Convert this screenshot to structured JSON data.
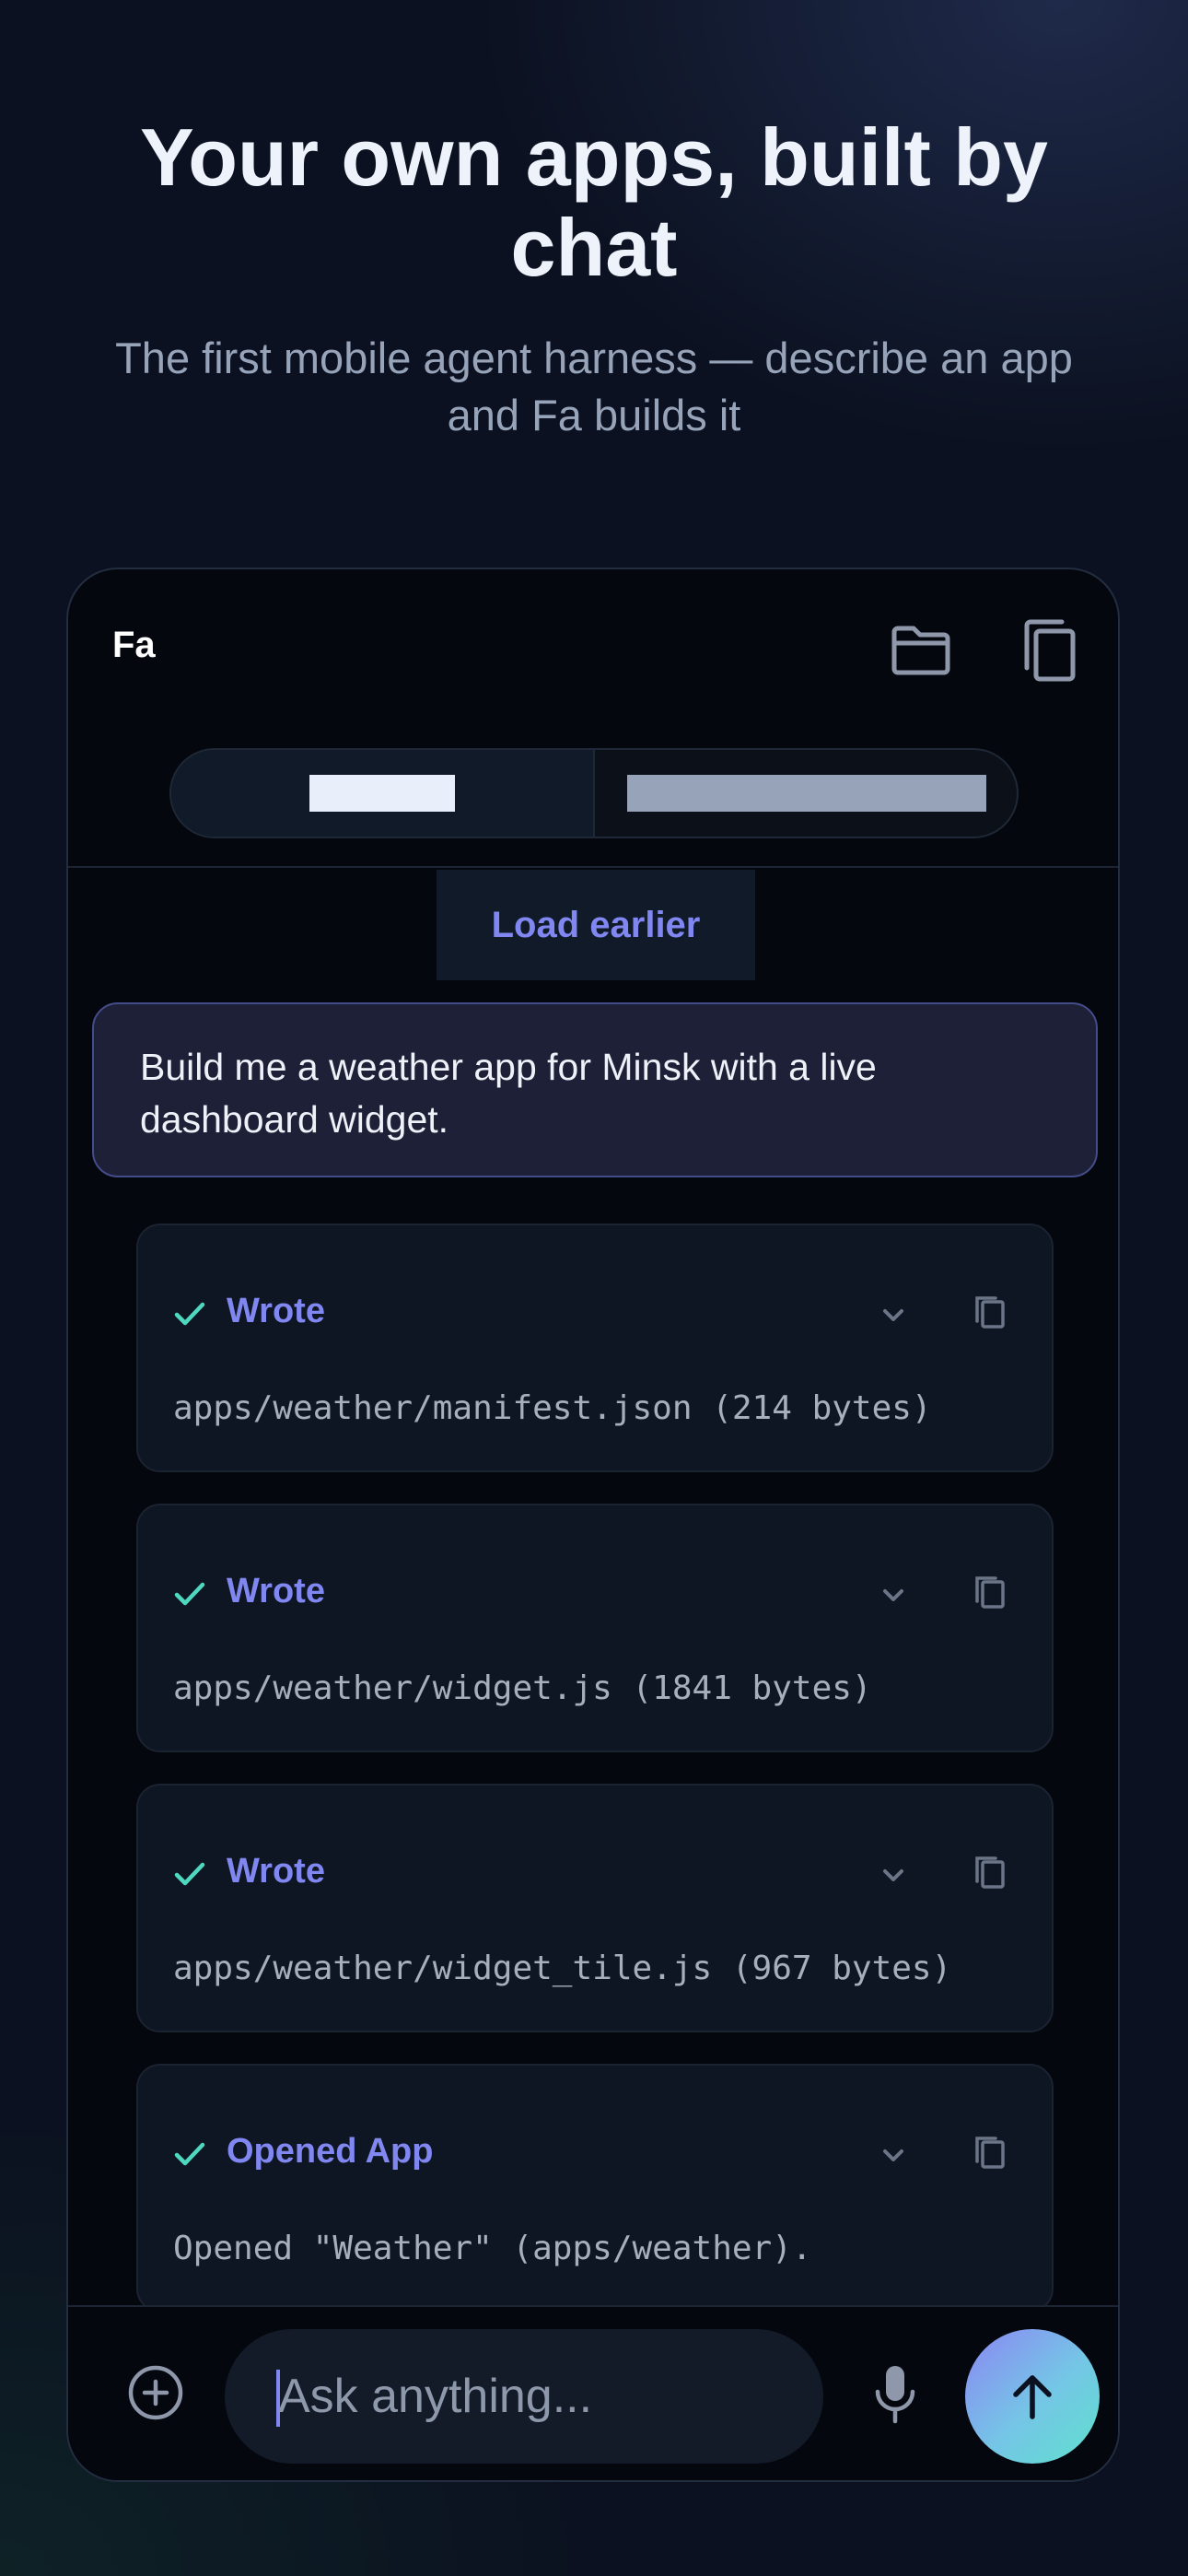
{
  "hero": {
    "title": "Your own apps, built by chat",
    "subtitle": "The first mobile agent harness — describe an app and Fa builds it"
  },
  "app": {
    "name": "Fa",
    "header_icons": [
      "folder-icon",
      "copy-icon"
    ]
  },
  "chat": {
    "load_earlier": "Load earlier",
    "user_message": "Build me a weather app for Minsk with a live dashboard widget.",
    "tool_calls": [
      {
        "title": "Wrote",
        "detail": "apps/weather/manifest.json (214 bytes)",
        "status_icon": "check-icon"
      },
      {
        "title": "Wrote",
        "detail": "apps/weather/widget.js (1841 bytes)",
        "status_icon": "check-icon"
      },
      {
        "title": "Wrote",
        "detail": "apps/weather/widget_tile.js (967 bytes)",
        "status_icon": "check-icon"
      },
      {
        "title": "Opened App",
        "detail": "Opened \"Weather\" (apps/weather).",
        "status_icon": "check-icon"
      }
    ]
  },
  "composer": {
    "placeholder": "Ask anything...",
    "value": ""
  },
  "colors": {
    "accent": "#8187f0",
    "check": "#4fd8c0",
    "background": "#0b1120",
    "panel": "#04070d",
    "card": "#0f1623"
  }
}
